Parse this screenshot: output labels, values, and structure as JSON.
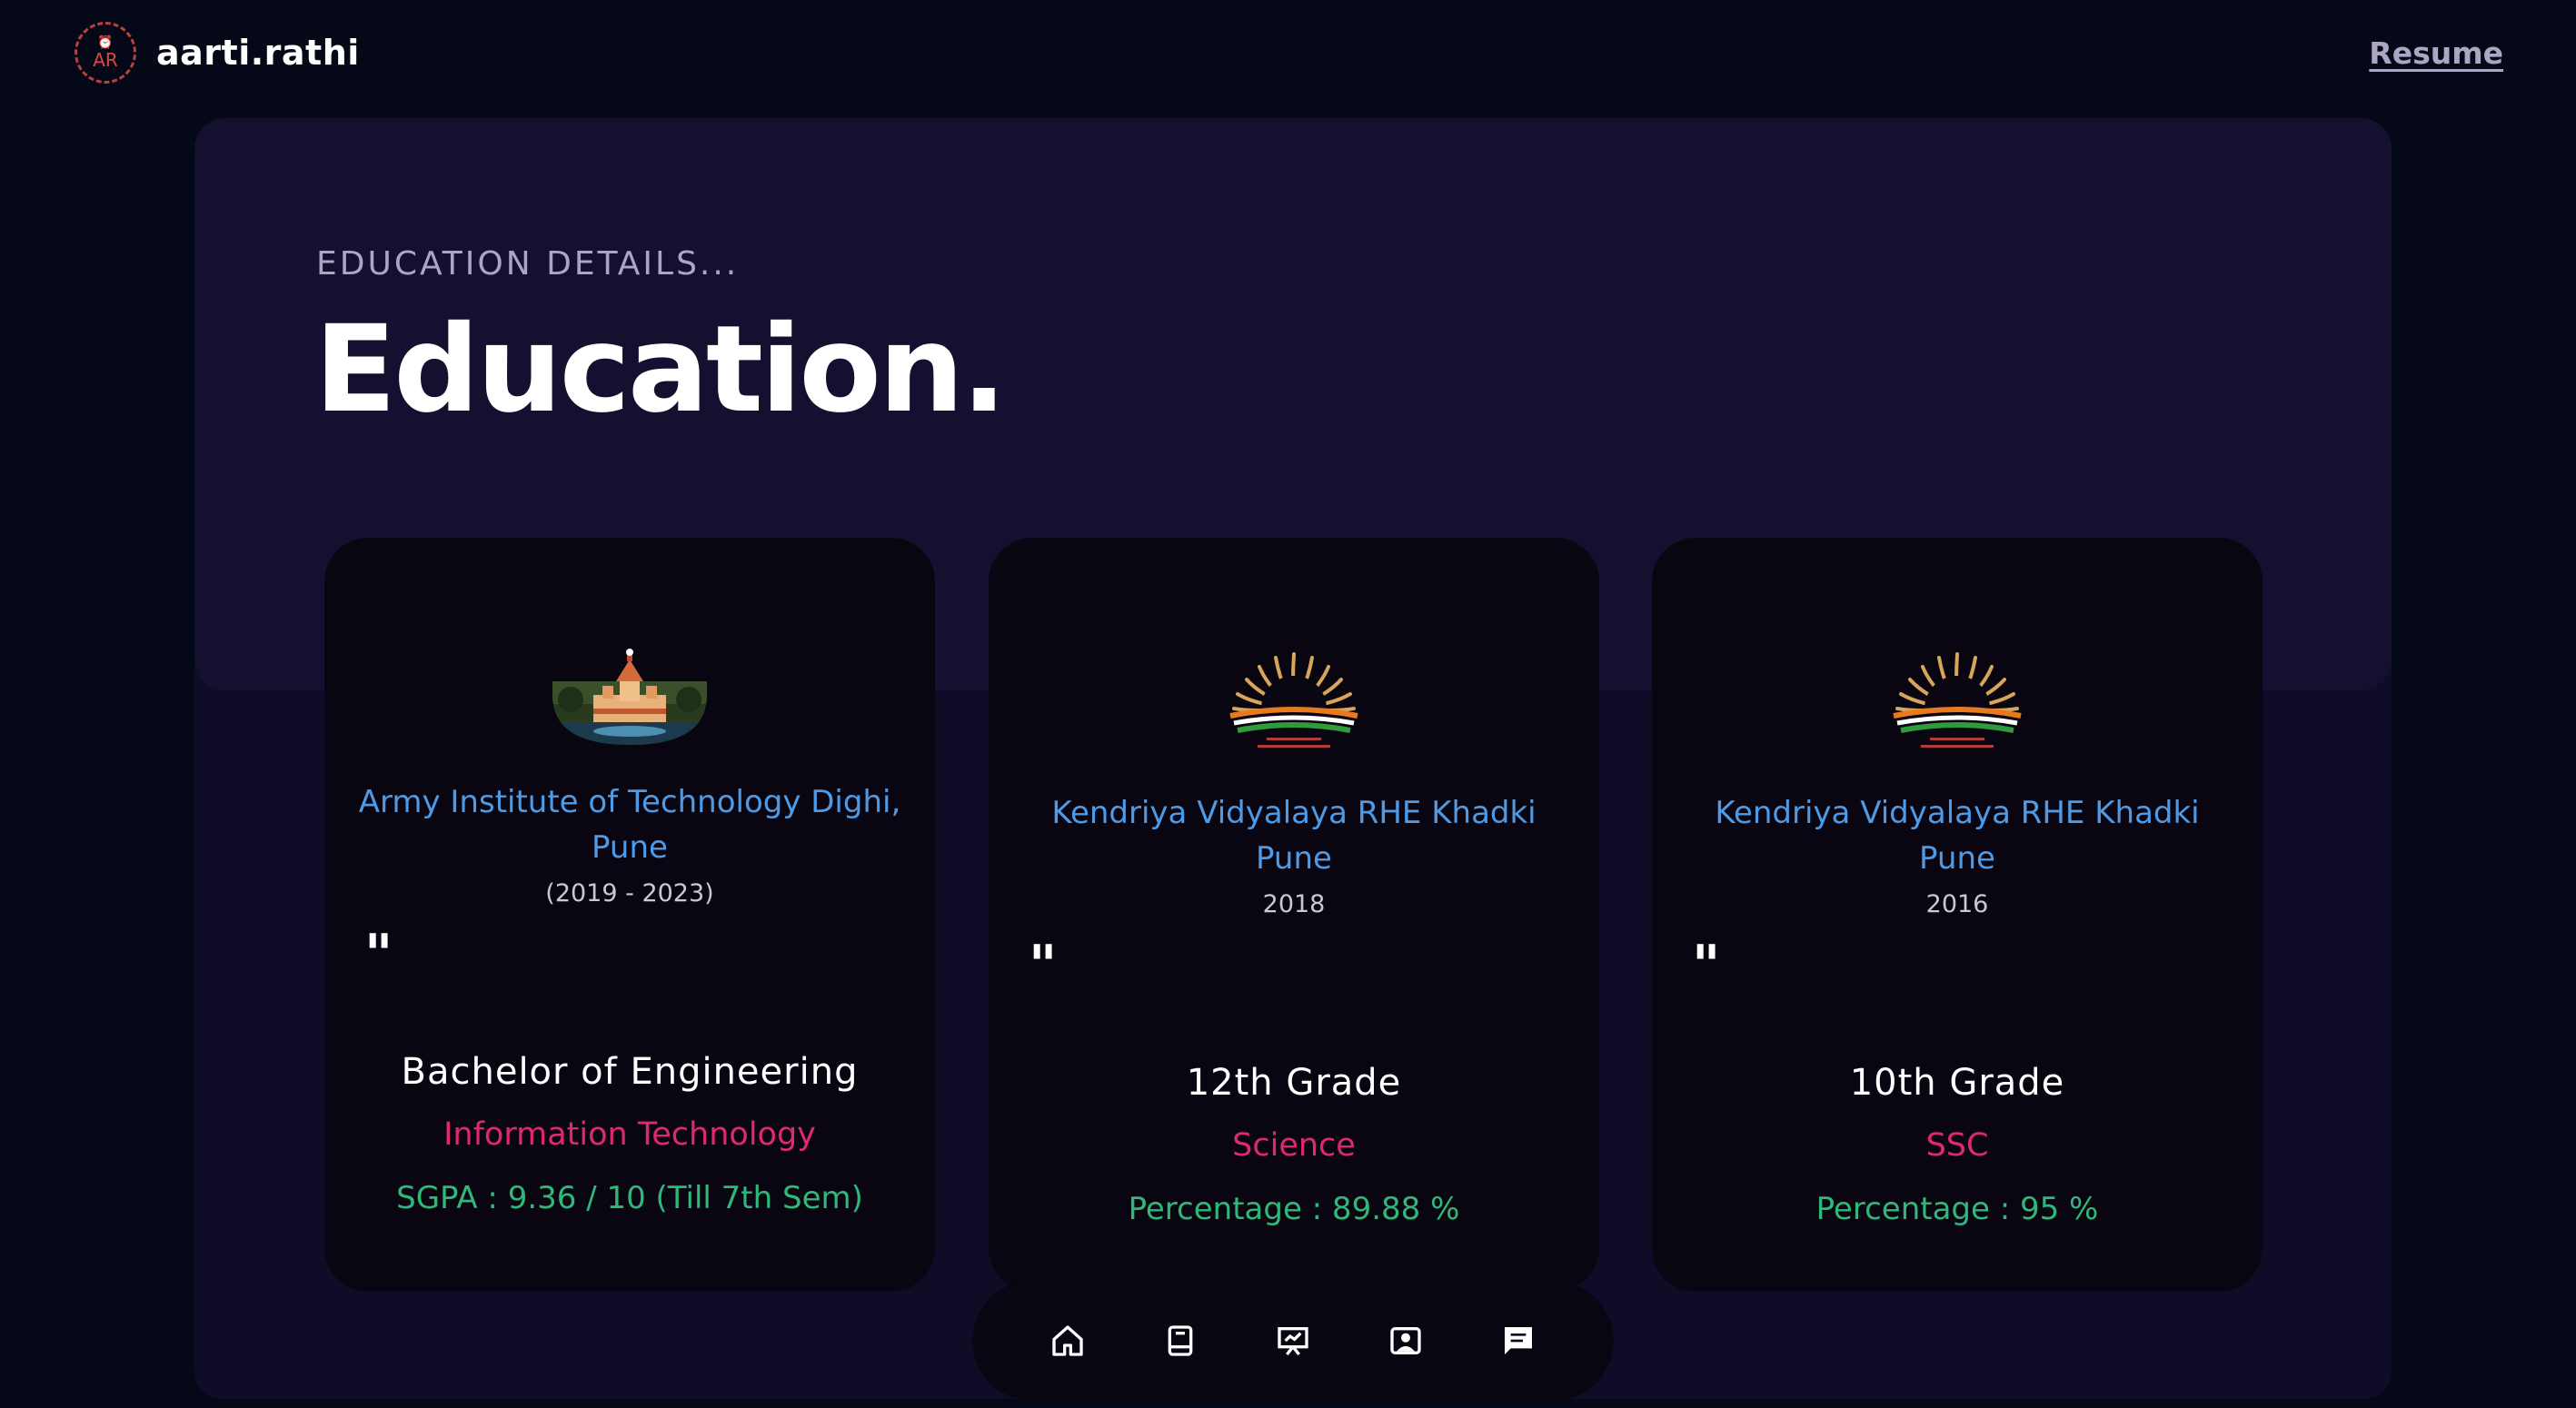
{
  "brand": {
    "logo_text": "AR",
    "name": "aarti.rathi"
  },
  "nav": {
    "resume_label": "Resume"
  },
  "section": {
    "subtitle": "EDUCATION DETAILS...",
    "heading": "Education."
  },
  "cards": [
    {
      "logo_icon": "college-building-logo",
      "school": "Army Institute of Technology Dighi, Pune",
      "years": "(2019 - 2023)",
      "quote_mark": "\"",
      "degree": "Bachelor of Engineering",
      "field": "Information Technology",
      "score": "SGPA : 9.36 / 10 (Till 7th Sem)"
    },
    {
      "logo_icon": "kendriya-vidyalaya-sun-logo",
      "school": "Kendriya Vidyalaya RHE Khadki Pune",
      "years": "2018",
      "quote_mark": "\"",
      "degree": "12th Grade",
      "field": "Science",
      "score": "Percentage : 89.88 %"
    },
    {
      "logo_icon": "kendriya-vidyalaya-sun-logo",
      "school": "Kendriya Vidyalaya RHE Khadki Pune",
      "years": "2016",
      "quote_mark": "\"",
      "degree": "10th Grade",
      "field": "SSC",
      "score": "Percentage : 95 %"
    }
  ],
  "dock": {
    "items": [
      "home-icon",
      "book-icon",
      "presentation-icon",
      "contact-card-icon",
      "chat-icon"
    ]
  },
  "colors": {
    "background": "#050816",
    "panel": "#151030",
    "card": "#090612",
    "school_blue": "#4d9be6",
    "field_pink": "#e0296c",
    "score_green": "#2eb87a",
    "muted": "#aaa6c3"
  }
}
